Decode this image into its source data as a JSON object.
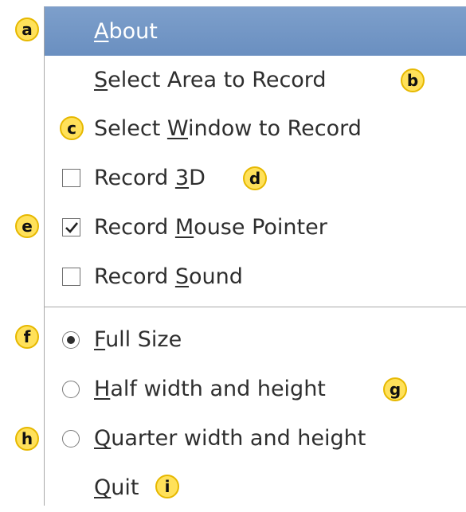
{
  "menu": {
    "items": [
      {
        "pre": "",
        "key": "A",
        "post": "bout"
      },
      {
        "pre": "",
        "key": "S",
        "post": "elect Area to Record"
      },
      {
        "pre": "Select ",
        "key": "W",
        "post": "indow to Record"
      },
      {
        "pre": "Record ",
        "key": "3",
        "post": "D",
        "checked": false
      },
      {
        "pre": "Record ",
        "key": "M",
        "post": "ouse Pointer",
        "checked": true
      },
      {
        "pre": "Record ",
        "key": "S",
        "post": "ound",
        "checked": false
      },
      {
        "pre": "",
        "key": "F",
        "post": "ull Size",
        "selected": true
      },
      {
        "pre": "",
        "key": "H",
        "post": "alf width and height",
        "selected": false
      },
      {
        "pre": "",
        "key": "Q",
        "post": "uarter width and height",
        "selected": false
      },
      {
        "pre": "",
        "key": "Q",
        "post": "uit"
      }
    ]
  },
  "annotations": [
    "a",
    "b",
    "c",
    "d",
    "e",
    "f",
    "g",
    "h",
    "i"
  ],
  "colors": {
    "highlight": "#7596c6",
    "badge_fill": "#ffe15a",
    "badge_border": "#e6b800",
    "text": "#2e2e2e"
  },
  "icons": {
    "checkbox_checked": "check-mark",
    "radio_selected": "radio-dot"
  }
}
